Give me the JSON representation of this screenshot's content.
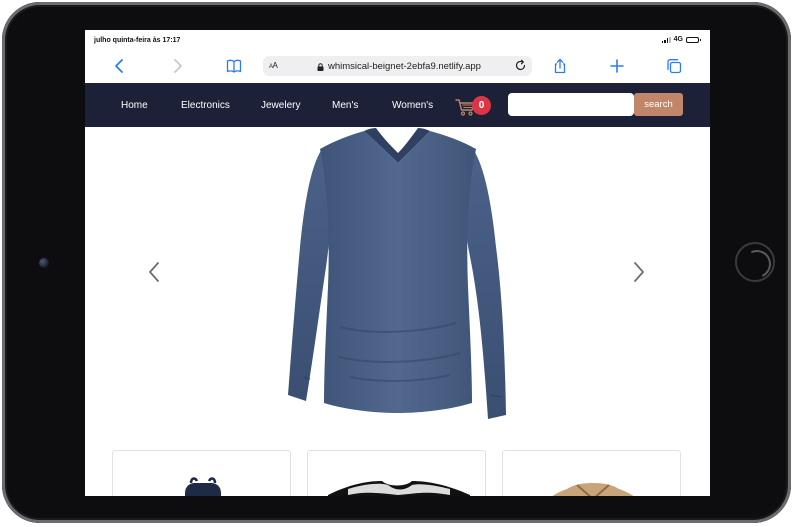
{
  "status_bar": {
    "time": "julho quinta-feira às 17:17",
    "network": "4G"
  },
  "browser": {
    "text_size_label": "AA",
    "url": "whimsical-beignet-2ebfa9.netlify.app"
  },
  "nav": {
    "links": [
      "Home",
      "Electronics",
      "Jewelery",
      "Men's",
      "Women's"
    ],
    "cart_count": "0"
  },
  "search": {
    "placeholder": "",
    "value": "",
    "button_label": "search"
  },
  "colors": {
    "nav_background": "#1d2137",
    "search_button": "#c1856a",
    "cart_badge": "#dc3545",
    "browser_accent": "#2b7bf5"
  },
  "icons": {
    "back": "chevron-left-icon",
    "forward": "chevron-right-icon",
    "bookmarks": "book-icon",
    "lock": "lock-icon",
    "reload": "reload-icon",
    "share": "share-icon",
    "add": "plus-icon",
    "tabs": "tabs-icon",
    "cart": "cart-icon",
    "carousel_prev": "chevron-left-icon",
    "carousel_next": "chevron-right-icon"
  }
}
